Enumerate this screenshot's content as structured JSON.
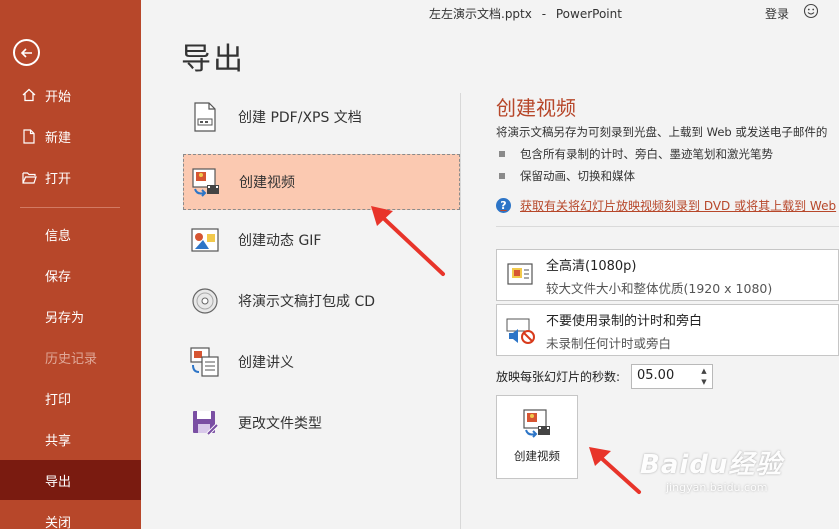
{
  "titlebar": {
    "document": "左左演示文档.pptx",
    "separator": "-",
    "app": "PowerPoint",
    "login": "登录",
    "smile": "☺"
  },
  "sidebar": {
    "items": [
      {
        "label": "开始",
        "icon": "home-icon"
      },
      {
        "label": "新建",
        "icon": "new-file-icon"
      },
      {
        "label": "打开",
        "icon": "open-folder-icon"
      },
      {
        "label": "信息"
      },
      {
        "label": "保存"
      },
      {
        "label": "另存为"
      },
      {
        "label": "历史记录",
        "disabled": true
      },
      {
        "label": "打印"
      },
      {
        "label": "共享"
      },
      {
        "label": "导出",
        "active": true
      },
      {
        "label": "关闭"
      }
    ],
    "colors": {
      "background": "#b7472a",
      "active": "#7a1b10"
    }
  },
  "page_title": "导出",
  "export_options": [
    {
      "label": "创建 PDF/XPS 文档",
      "icon": "pdf-xps-icon"
    },
    {
      "label": "创建视频",
      "icon": "video-icon",
      "selected": true
    },
    {
      "label": "创建动态 GIF",
      "icon": "gif-icon"
    },
    {
      "label": "将演示文稿打包成 CD",
      "icon": "cd-icon"
    },
    {
      "label": "创建讲义",
      "icon": "handout-icon"
    },
    {
      "label": "更改文件类型",
      "icon": "file-type-icon"
    }
  ],
  "right_panel": {
    "title": "创建视频",
    "description": "将演示文稿另存为可刻录到光盘、上载到 Web 或发送电子邮件的",
    "bullets": [
      "包含所有录制的计时、旁白、墨迹笔划和激光笔势",
      "保留动画、切换和媒体"
    ],
    "help_link": "获取有关将幻灯片放映视频刻录到 DVD 或将其上载到 Web",
    "quality_dropdown": {
      "title": "全高清(1080p)",
      "subtitle": "较大文件大小和整体优质(1920 x 1080)"
    },
    "timing_dropdown": {
      "title": "不要使用录制的计时和旁白",
      "subtitle": "未录制任何计时或旁白"
    },
    "seconds_label": "放映每张幻灯片的秒数:",
    "seconds_value": "05.00",
    "create_button": "创建视频",
    "accent": "#b7472a"
  },
  "watermark": {
    "line1": "Baidu经验",
    "line2": "jingyan.baidu.com"
  }
}
